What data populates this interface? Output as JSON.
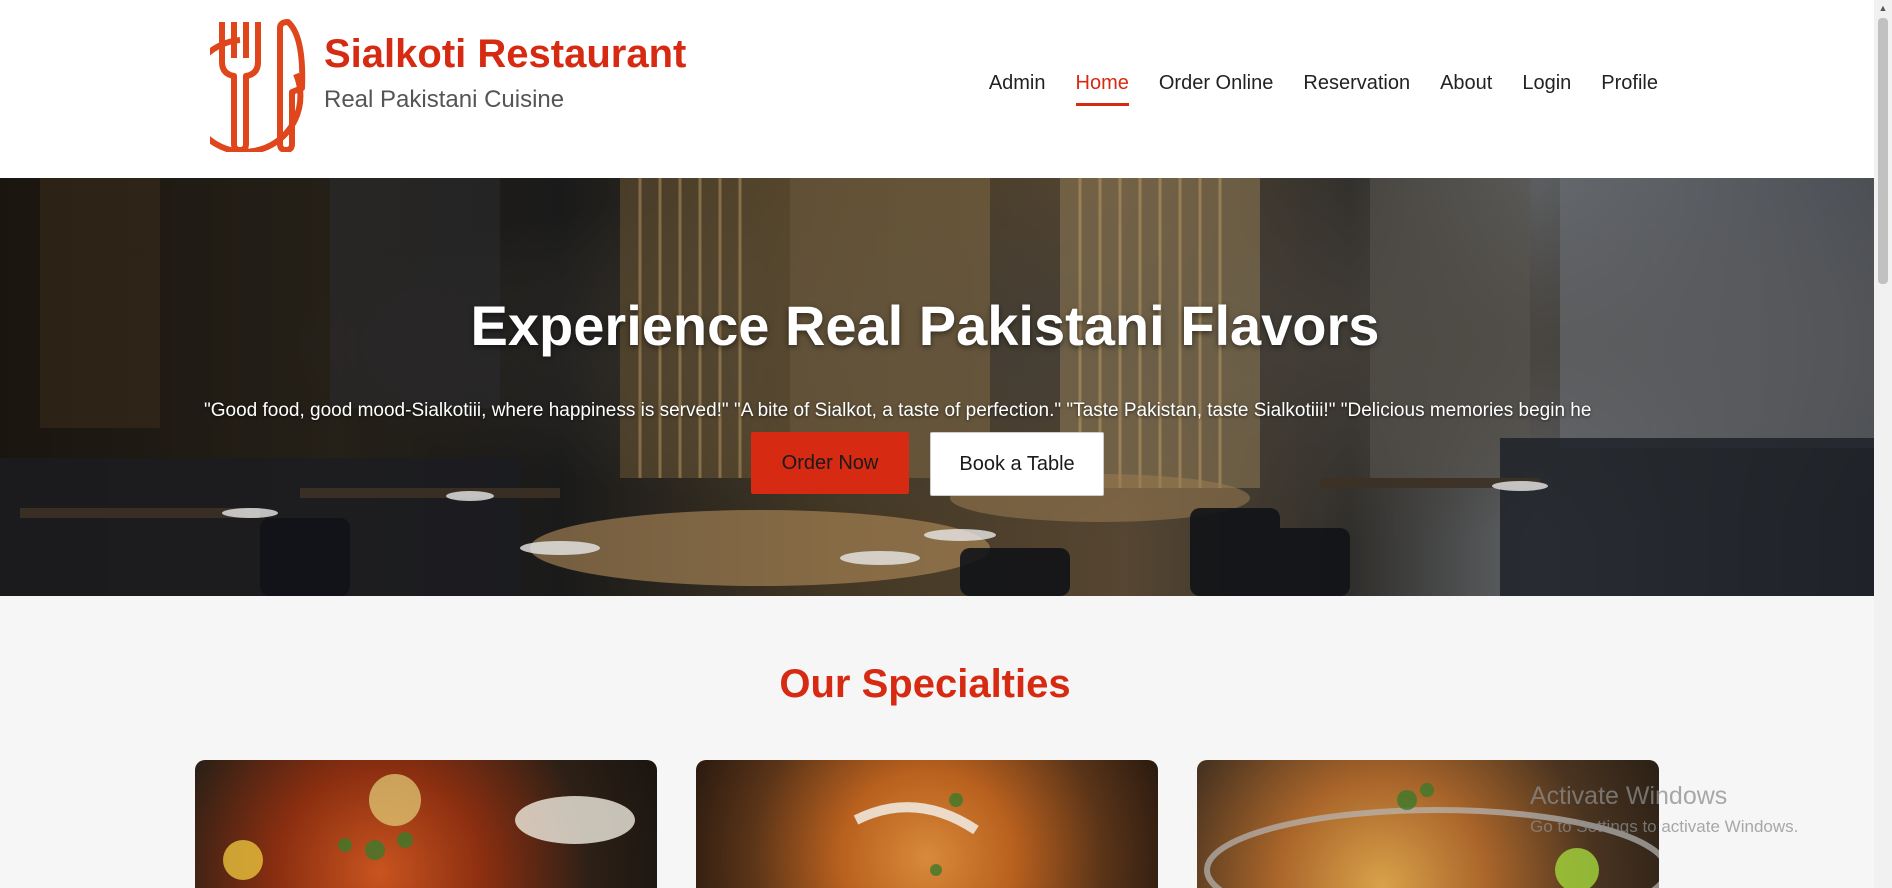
{
  "header": {
    "brand_name": "Sialkoti Restaurant",
    "tagline": "Real Pakistani Cuisine",
    "logo_icon": "fork-knife-plate-icon",
    "accent_color": "#d62a12"
  },
  "nav": {
    "items": [
      {
        "label": "Admin",
        "active": false
      },
      {
        "label": "Home",
        "active": true
      },
      {
        "label": "Order Online",
        "active": false
      },
      {
        "label": "Reservation",
        "active": false
      },
      {
        "label": "About",
        "active": false
      },
      {
        "label": "Login",
        "active": false
      },
      {
        "label": "Profile",
        "active": false
      }
    ]
  },
  "hero": {
    "title": "Experience Real Pakistani Flavors",
    "quotes": "\"Good food, good mood-Sialkotiii, where happiness is served!\" \"A bite of Sialkot, a taste of perfection.\" \"Taste Pakistan, taste Sialkotiii!\" \"Delicious memories begin he",
    "order_button": "Order Now",
    "book_button": "Book a Table"
  },
  "specialties": {
    "title": "Our Specialties",
    "cards": [
      "chicken-karahi-image",
      "butter-chicken-image",
      "biryani-image"
    ]
  },
  "watermark": {
    "title": "Activate Windows",
    "subtitle": "Go to Settings to activate Windows."
  }
}
